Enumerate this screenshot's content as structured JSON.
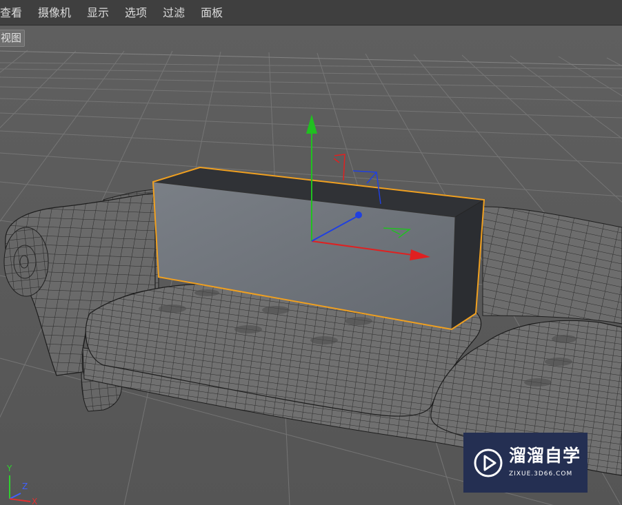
{
  "menu": {
    "items": [
      {
        "label": "查看"
      },
      {
        "label": "摄像机"
      },
      {
        "label": "显示"
      },
      {
        "label": "选项"
      },
      {
        "label": "过滤"
      },
      {
        "label": "面板"
      }
    ]
  },
  "viewport": {
    "label": "视图"
  },
  "axis_indicator": {
    "y_label": "Y",
    "z_label": "Z",
    "x_label": "X"
  },
  "watermark": {
    "title": "溜溜自学",
    "url": "ZIXUE.3D66.COM"
  },
  "colors": {
    "menubar": "#3f3f3f",
    "viewport_bg": "#595959",
    "selection_outline": "#f0a020",
    "axis_x": "#e02020",
    "axis_y": "#20c020",
    "axis_z": "#2040e0",
    "watermark_bg": "#242f52"
  }
}
